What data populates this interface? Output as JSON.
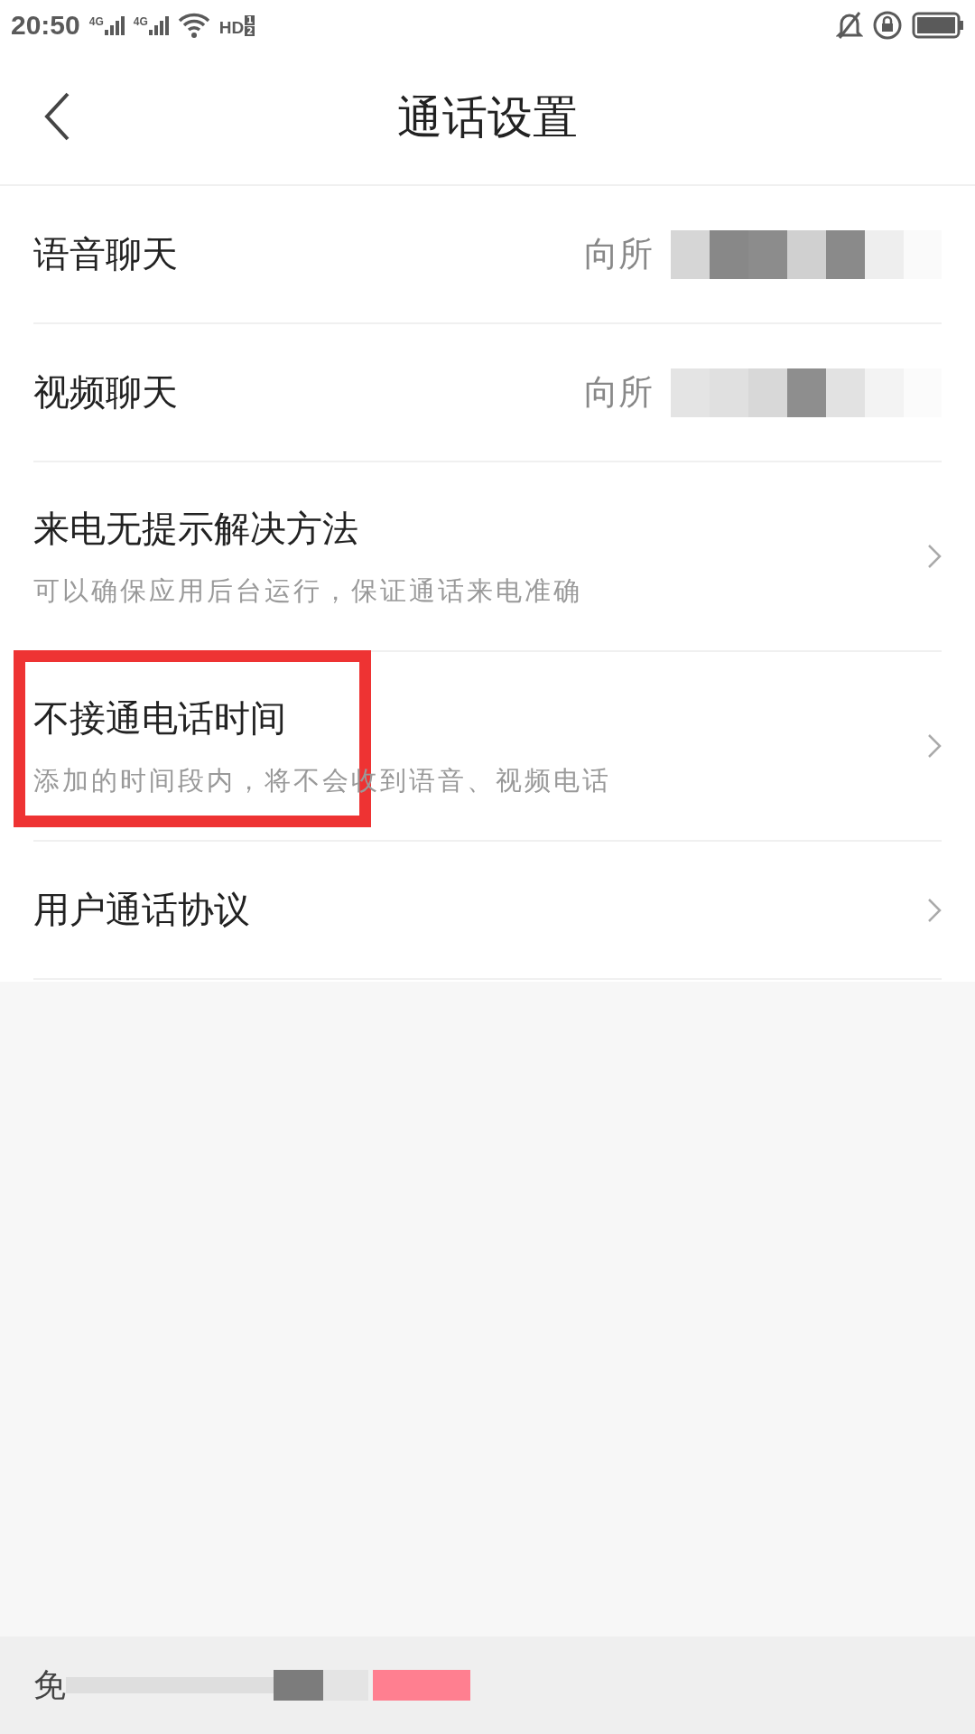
{
  "status_bar": {
    "time": "20:50",
    "networks": [
      {
        "label": "4G"
      },
      {
        "label": "4G"
      }
    ],
    "hd": {
      "label": "HD",
      "slots": [
        "1",
        "2"
      ]
    }
  },
  "header": {
    "title": "通话设置"
  },
  "rows": [
    {
      "kind": "value",
      "title": "语音聊天",
      "value": "向所"
    },
    {
      "kind": "value",
      "title": "视频聊天",
      "value": "向所"
    },
    {
      "kind": "link",
      "title": "来电无提示解决方法",
      "subtitle": "可以确保应用后台运行，保证通话来电准确",
      "highlighted": false
    },
    {
      "kind": "link",
      "title": "不接通电话时间",
      "subtitle": "添加的时间段内，将不会收到语音、视频电话",
      "highlighted": true
    },
    {
      "kind": "link",
      "title": "用户通话协议",
      "highlighted": false
    }
  ],
  "footer": {
    "text": "免"
  }
}
